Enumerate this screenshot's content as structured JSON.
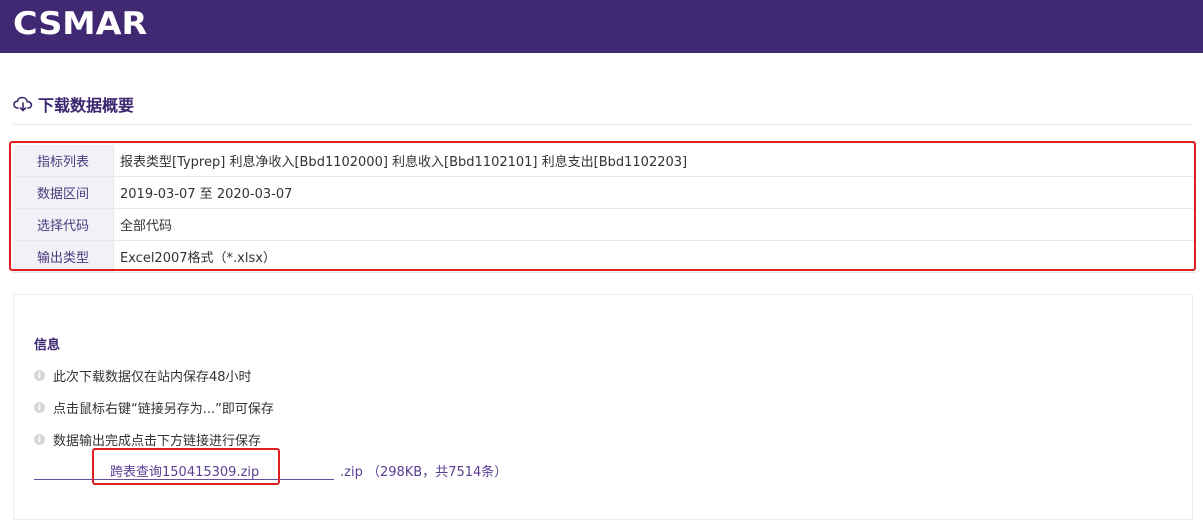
{
  "header": {
    "logo_text": "CSMAR"
  },
  "section": {
    "title": "下载数据概要",
    "icon": "cloud-download-icon"
  },
  "summary": [
    {
      "key": "指标列表",
      "value": "报表类型[Typrep] 利息净收入[Bbd1102000] 利息收入[Bbd1102101] 利息支出[Bbd1102203]"
    },
    {
      "key": "数据区间",
      "value": "2019-03-07 至 2020-03-07"
    },
    {
      "key": "选择代码",
      "value": "全部代码"
    },
    {
      "key": "输出类型",
      "value": "Excel2007格式（*.xlsx）"
    }
  ],
  "info": {
    "heading": "信息",
    "lines": [
      "此次下载数据仅在站内保存48小时",
      "点击鼠标右键“链接另存为...”即可保存",
      "数据输出完成点击下方链接进行保存"
    ],
    "info_icon_glyph": "i"
  },
  "download": {
    "file_label": "跨表查询150415309.zip",
    "meta": ".zip （298KB，共7514条）"
  },
  "colors": {
    "brand": "#412873",
    "accent_text": "#3b2770",
    "highlight_box": "#e02020"
  }
}
